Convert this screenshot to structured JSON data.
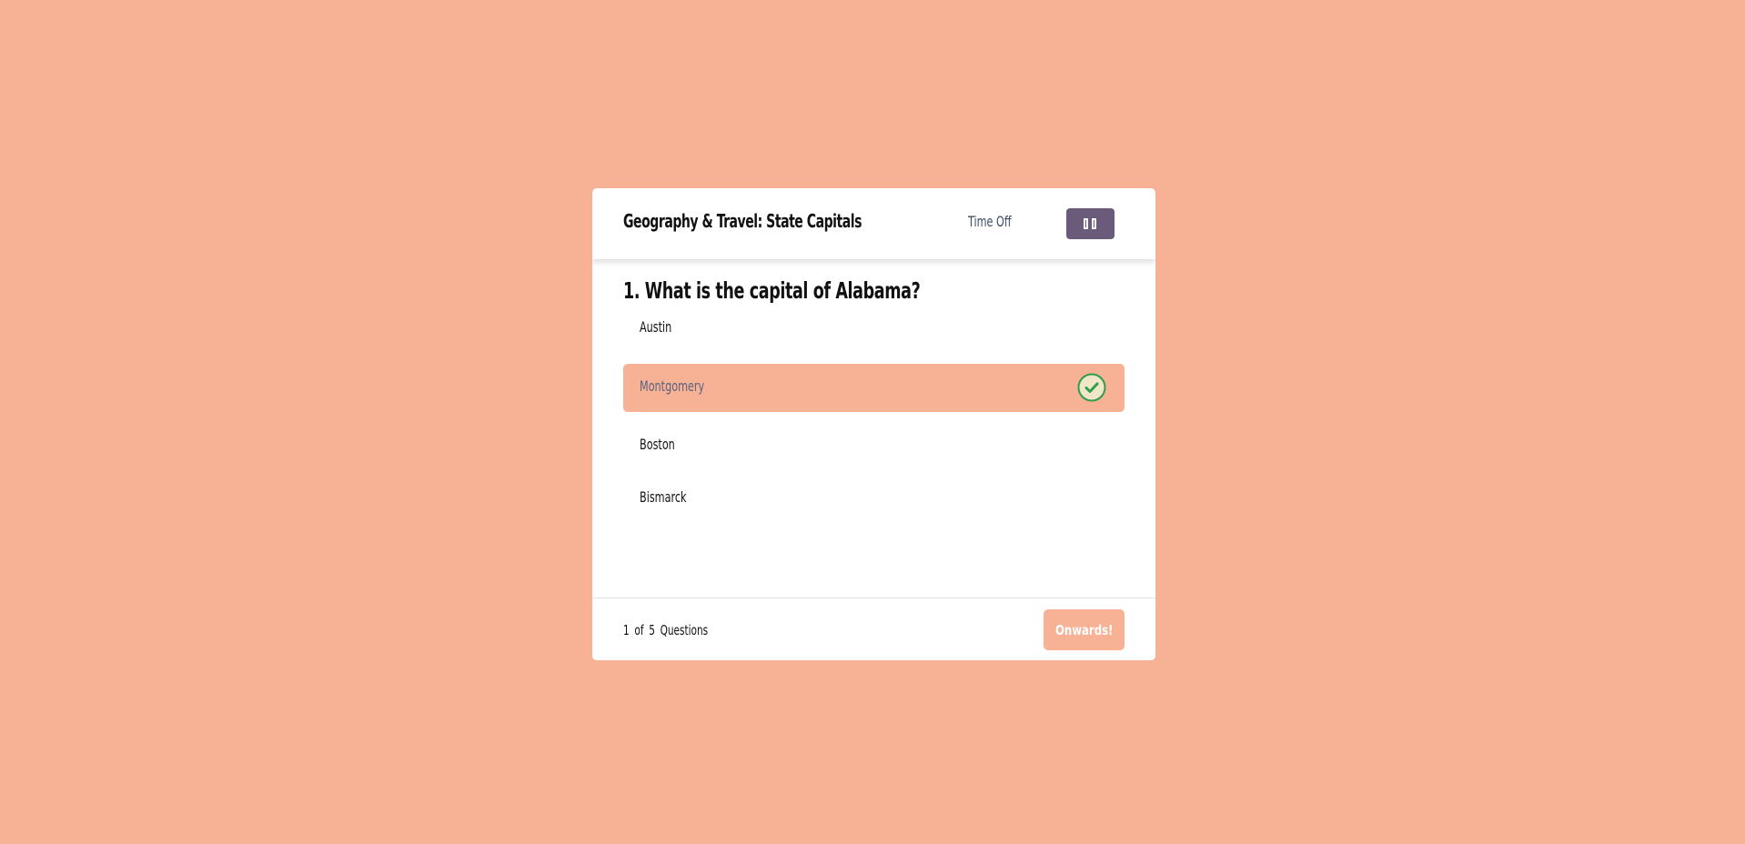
{
  "quiz": {
    "title": "Geography & Travel: State Capitals",
    "timer_label": "Time Off"
  },
  "question": {
    "text": "1. What is the capital of Alabama?"
  },
  "options": [
    {
      "label": "Austin",
      "selected": false
    },
    {
      "label": "Montgomery",
      "selected": true
    },
    {
      "label": "Boston",
      "selected": false
    },
    {
      "label": "Bismarck",
      "selected": false
    }
  ],
  "footer": {
    "progress": "1 of 5 Questions",
    "next_label": "Onwards!"
  },
  "colors": {
    "background": "#f7b195",
    "accent": "#6b5b7b",
    "correct": "#2e9e4f"
  },
  "icons": {
    "timer_toggle": "pause-icon",
    "selected_option": "check-circle-icon"
  }
}
